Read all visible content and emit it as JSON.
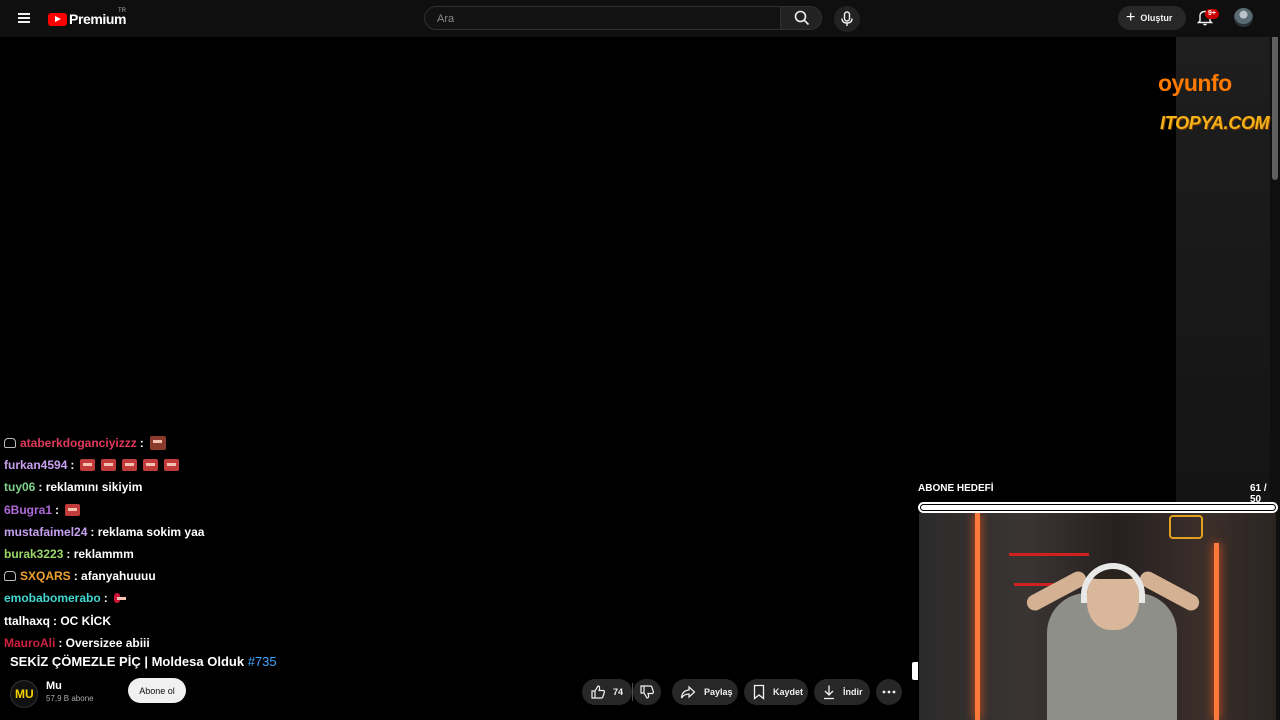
{
  "header": {
    "logo_text": "Premium",
    "country_code": "TR",
    "search_placeholder": "Ara",
    "create_label": "Oluştur",
    "notification_badge": "9+"
  },
  "overlay": {
    "sponsors": [
      "oyunfo",
      "ITOPYA.COM"
    ],
    "sub_goal": {
      "label": "ABONE HEDEFİ",
      "count": "61 / 50",
      "progress": 1.0
    },
    "chat": [
      {
        "user": "ataberkdoganciyizzz",
        "color": "#e03a5a",
        "text": ":",
        "badge": true,
        "emotes": 1,
        "emote_type": "big"
      },
      {
        "user": "furkan4594",
        "color": "#c8a0f0",
        "text": ":",
        "badge": false,
        "emotes": 5,
        "emote_type": "normal"
      },
      {
        "user": "tuy06",
        "color": "#7fd48a",
        "text": ": reklamını sikiyim",
        "badge": false,
        "emotes": 0
      },
      {
        "user": "6Bugra1",
        "color": "#b06ad8",
        "text": ":",
        "badge": false,
        "emotes": 1,
        "emote_type": "normal"
      },
      {
        "user": "mustafaimel24",
        "color": "#c8a0f0",
        "text": ": reklama sokim yaa",
        "badge": false,
        "emotes": 0
      },
      {
        "user": "burak3223",
        "color": "#9ad86a",
        "text": ": reklammm",
        "badge": false,
        "emotes": 0
      },
      {
        "user": "SXQARS",
        "color": "#f0a030",
        "text": ": afanyahuuuu",
        "badge": true,
        "emotes": 0
      },
      {
        "user": "emobabomerabo",
        "color": "#40d8d0",
        "text": ":",
        "badge": false,
        "emotes": 1,
        "emote_type": "small"
      },
      {
        "user": "ttalhaxq",
        "color": "#ffffff",
        "text": ": OC KİCK",
        "badge": false,
        "emotes": 0
      },
      {
        "user": "MauroAli",
        "color": "#d02040",
        "text": ": Oversizee abiii",
        "badge": false,
        "emotes": 0
      }
    ]
  },
  "video": {
    "title": "SEKİZ ÇÖMEZLE PİÇ | Moldesa Olduk",
    "tag": "#735",
    "channel_initials": "MU",
    "channel_name": "Mu",
    "subscribers": "57,9 B abone",
    "subscribe_label": "Abone ol",
    "like_count": "74",
    "share_label": "Paylaş",
    "save_label": "Kaydet",
    "download_label": "İndir"
  }
}
